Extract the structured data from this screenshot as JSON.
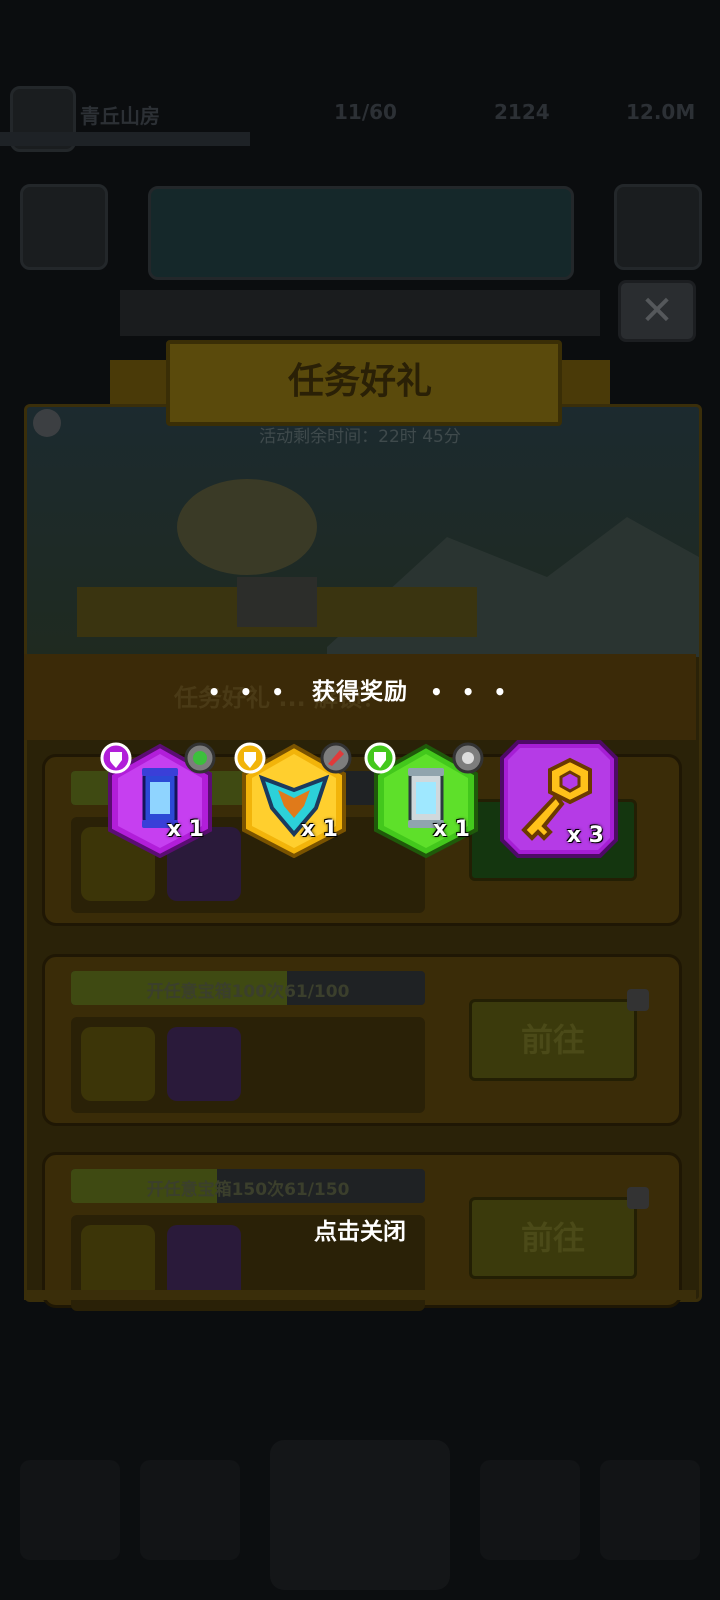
{
  "background": {
    "player_name": "青丘山房",
    "resources": [
      "11/60",
      "2124",
      "12.0M"
    ],
    "event_title": "任务好礼",
    "event_timer": "活动剩余时间：22时 45分",
    "unlock_strip": "任务好礼 ... 解锁！",
    "tasks": [
      {
        "label": "开任意宝箱100次61/100",
        "progress": 0.61,
        "go_label": "前往"
      },
      {
        "label": "开任意宝箱150次61/150",
        "progress": 0.41,
        "go_label": "前往"
      }
    ]
  },
  "popup": {
    "title": "获得奖励",
    "close_hint": "点击关闭",
    "rewards": [
      {
        "name": "purple-capsule-icon",
        "quantity": "x 1",
        "color": "#b11ed9"
      },
      {
        "name": "gold-crest-icon",
        "quantity": "x 1",
        "color": "#f2b40a"
      },
      {
        "name": "green-canister-icon",
        "quantity": "x 1",
        "color": "#43c81c"
      },
      {
        "name": "golden-key-icon",
        "quantity": "x 3",
        "color": "#a51ed4"
      }
    ]
  }
}
